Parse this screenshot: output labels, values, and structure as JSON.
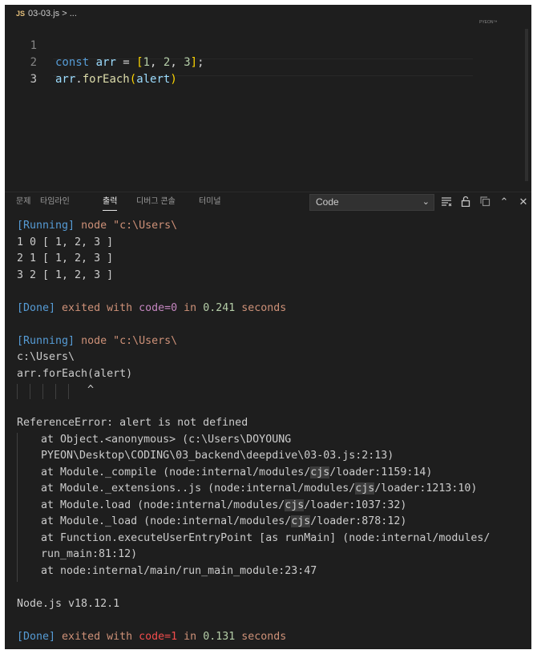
{
  "breadcrumb": {
    "lang_badge": "JS",
    "file": "03-03.js",
    "sep": ">",
    "tail": "..."
  },
  "minimap": {
    "label": "PYEON™"
  },
  "editor": {
    "line_numbers": [
      "1",
      "2",
      "3"
    ],
    "line1": {
      "kw": "const",
      "name": " arr",
      "eq": " = ",
      "open": "[",
      "n1": "1",
      "c1": ", ",
      "n2": "2",
      "c2": ", ",
      "n3": "3",
      "close": "]",
      "semi": ";"
    },
    "line2": {
      "obj": "arr",
      "dot": ".",
      "method": "forEach",
      "open": "(",
      "arg": "alert",
      "close": ")"
    }
  },
  "panel": {
    "tabs": [
      "문제",
      "타임라인",
      "출력",
      "디버그 콘솔",
      "터미널"
    ],
    "active_tab": "출력",
    "channel_select": "Code",
    "icons": [
      "clear-output-icon",
      "lock-scroll-icon",
      "copy-icon",
      "maximize-panel-icon",
      "close-panel-icon"
    ]
  },
  "output": {
    "run1_tag": "[Running]",
    "run1_cmd": " node \"c:\\Users\\",
    "l1": "1 0 [ 1, 2, 3 ]",
    "l2": "2 1 [ 1, 2, 3 ]",
    "l3": "3 2 [ 1, 2, 3 ]",
    "done1": {
      "tag": "[Done]",
      "exited": " exited with ",
      "code": "code=0",
      "in": " in ",
      "time": "0.241",
      "unit": " seconds"
    },
    "run2_tag": "[Running]",
    "run2_cmd": " node \"c:\\Users\\",
    "path": "c:\\Users\\",
    "src": "arr.forEach(alert)",
    "caret": "^",
    "error": "ReferenceError: alert is not defined",
    "stack1a": "at Object.<anonymous> (c:\\Users\\DOYOUNG",
    "stack1b": "PYEON\\Desktop\\CODING\\03_backend\\deepdive\\03-03.js:2:13)",
    "stack2": {
      "pre": "at Module._compile (node:internal/modules/",
      "hl": "cjs",
      "post": "/loader:1159:14)"
    },
    "stack3": {
      "pre": "at Module._extensions..js (node:internal/modules/",
      "hl": "cjs",
      "post": "/loader:1213:10)"
    },
    "stack4": {
      "pre": "at Module.load (node:internal/modules/",
      "hl": "cjs",
      "post": "/loader:1037:32)"
    },
    "stack5": {
      "pre": "at Module._load (node:internal/modules/",
      "hl": "cjs",
      "post": "/loader:878:12)"
    },
    "stack6a": "at Function.executeUserEntryPoint [as runMain] (node:internal/modules/",
    "stack6b": "run_main:81:12)",
    "stack7": "at node:internal/main/run_main_module:23:47",
    "node_version": "Node.js v18.12.1",
    "done2": {
      "tag": "[Done]",
      "exited": " exited with ",
      "code": "code=1",
      "in": " in ",
      "time": "0.131",
      "unit": " seconds"
    }
  },
  "colors": {
    "background": "#1e1e1e",
    "keyword": "#569cd6",
    "error_code": "#f14c4c",
    "success_code": "#c586c0",
    "number": "#b5cea8"
  }
}
